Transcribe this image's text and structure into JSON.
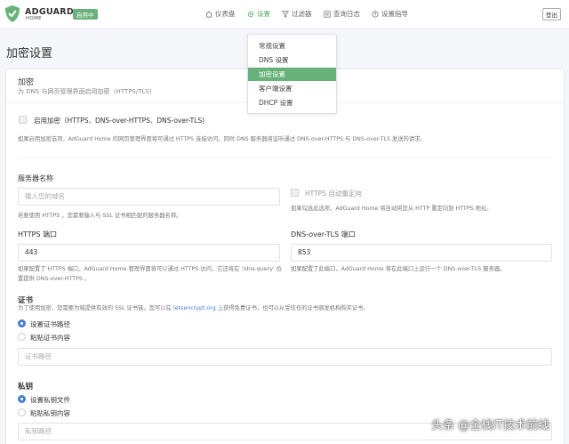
{
  "header": {
    "brand_name": "ADGUARD",
    "brand_sub": "HOME",
    "status_badge": "启用中",
    "nav": {
      "dashboard": "仪表盘",
      "settings": "设置",
      "filters": "过滤器",
      "query_log": "查询日志",
      "setup_guide": "设置指导"
    },
    "logout": "登出"
  },
  "settings_menu": {
    "items": [
      "常规设置",
      "DNS 设置",
      "加密设置",
      "客户端设置",
      "DHCP 设置"
    ],
    "active_index": 2
  },
  "page": {
    "title": "加密设置"
  },
  "encryption": {
    "title": "加密",
    "subtitle": "为 DNS 与网页管理界面启用加密（HTTPS/TLS)",
    "enable_label": "启用加密（HTTPS、DNS-over-HTTPS、DNS-over-TLS)",
    "enable_help": "如果启用加密选项，AdGuard Home 的网页管理界面将可通过 HTTPS 连接访问，同时 DNS 服务器将监听通过 DNS-over-HTTPS 与 DNS-over-TLS 发送的请求。",
    "server_name_title": "服务器名称",
    "server_name_placeholder": "输入您的域名",
    "server_name_help": "若要使用 HTTPS ，您需要输入与 SSL 证书相匹配的服务器名称。",
    "https_redirect_label": "HTTPS 自动重定向",
    "https_redirect_help": "如果勾选此选项，AdGuard Home 将自动将您从 HTTP 重定向到 HTTPS 地址。",
    "https_port_title": "HTTPS 端口",
    "https_port_value": "443",
    "https_port_help": "如果配置了 HTTPS 端口，AdGuard Home 管理界面将可以通过 HTTPS 访问，它还将在 '/dns-query' 位置提供 DNS-over-HTTPS 。",
    "tls_port_title": "DNS-over-TLS 端口",
    "tls_port_value": "853",
    "tls_port_help": "如果配置了此端口，AdGuard Home 将在此端口上运行一个 DNS-over-TLS 服务器。",
    "cert_title": "证书",
    "cert_help_prefix": "为了使用加密，您需要为域提供有效的 SSL 证书链。您可以在",
    "cert_help_link": "letsencrypt.org",
    "cert_help_suffix": "上获得免费证书，也可以从受信任的证书颁发机构购买证书。",
    "cert_option_path": "设置证书路径",
    "cert_option_paste": "粘贴证书内容",
    "cert_path_placeholder": "证书路径",
    "key_title": "私钥",
    "key_option_file": "设置私钥文件",
    "key_option_paste": "粘贴私钥内容",
    "key_path_placeholder": "私钥路径"
  },
  "watermark": "头条 @全栈IT技术前线",
  "colors": {
    "accent": "#67b279",
    "link": "#467fcf"
  }
}
